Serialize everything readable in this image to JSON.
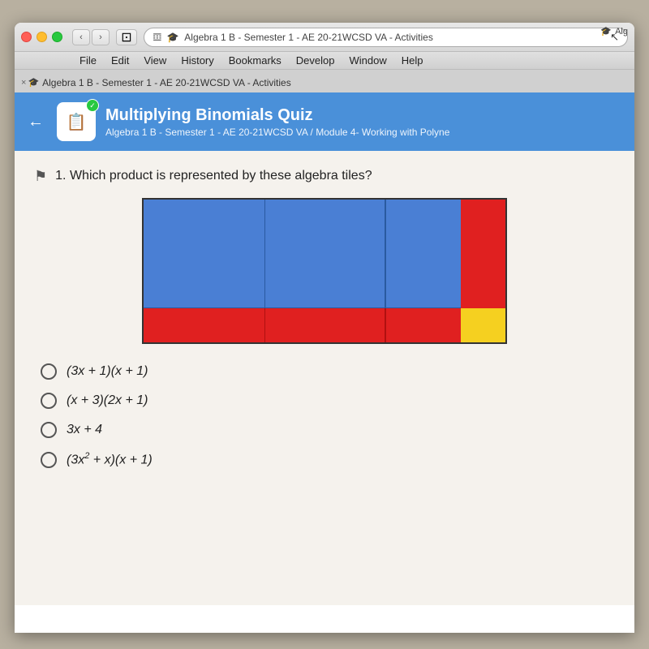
{
  "menubar": {
    "items": [
      "File",
      "Edit",
      "View",
      "History",
      "Bookmarks",
      "Develop",
      "Window",
      "Help"
    ]
  },
  "browser": {
    "tab_title": "Algebra 1 B - Semester 1 - AE 20-21WCSD VA - Activities",
    "reader_icon": "𝌞",
    "back_label": "‹",
    "forward_label": "›"
  },
  "quiz": {
    "title": "Multiplying Binomials Quiz",
    "subtitle": "Algebra 1 B - Semester 1 - AE 20-21WCSD VA / Module 4- Working with Polyne",
    "question_number": "1.",
    "question_text": "Which product is represented by these algebra tiles?",
    "answers": [
      {
        "id": "a",
        "text": "(3x + 1)(x + 1)"
      },
      {
        "id": "b",
        "text": "(x + 3)(2x + 1)"
      },
      {
        "id": "c",
        "text": "3x + 4"
      },
      {
        "id": "d",
        "text": "(3x² + x)(x + 1)"
      }
    ]
  },
  "icons": {
    "back_arrow": "←",
    "bookmark": "⚑",
    "check": "✓",
    "close": "×"
  }
}
